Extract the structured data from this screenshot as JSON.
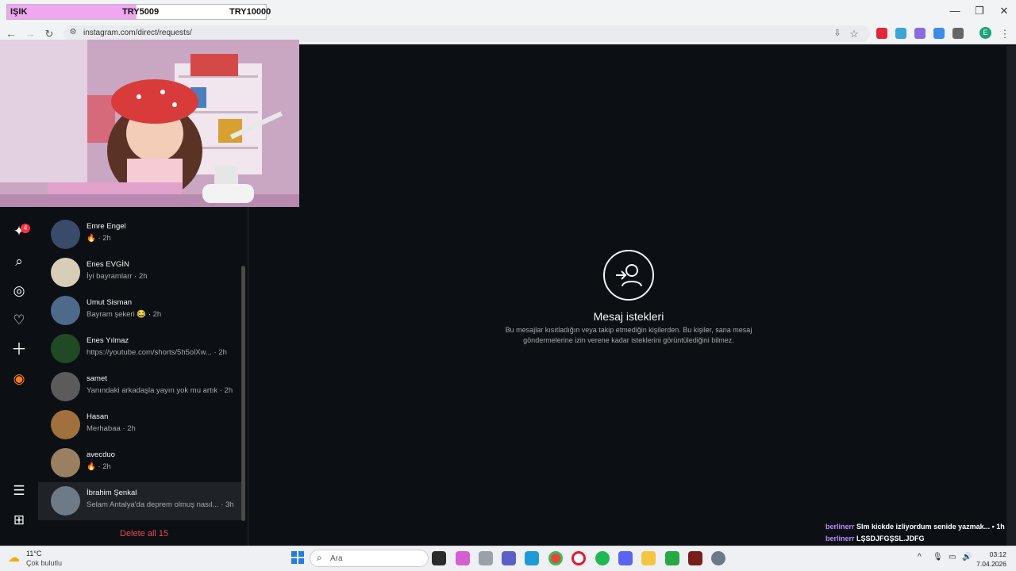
{
  "window": {
    "goal_label_left": "IŞIK",
    "goal_label_mid": "TRY5009",
    "goal_label_right": "TRY10000",
    "goal_progress": 0.5009
  },
  "browser": {
    "url": "instagram.com/direct/requests/",
    "profile_initial": "E"
  },
  "sidebar": {
    "notification_count": "4"
  },
  "requests": [
    {
      "name": "Emre Engel",
      "sub": "🔥 · 2h",
      "avatar_color": "#3a4a6a"
    },
    {
      "name": "Enes EVGİN",
      "sub": "İyi bayramlarr · 2h",
      "avatar_color": "#d8cdb6"
    },
    {
      "name": "Umut Sisman",
      "sub": "Bayram şekeri 😂 · 2h",
      "avatar_color": "#4d6a8a"
    },
    {
      "name": "Enes Yılmaz",
      "sub": "https://youtube.com/shorts/5h5olXw... · 2h",
      "avatar_color": "#1f4a24"
    },
    {
      "name": "samet",
      "sub": "Yanındaki arkadaşla yayın yok mu artık · 2h",
      "avatar_color": "#5b5b5b"
    },
    {
      "name": "Hasan",
      "sub": "Merhabaa · 2h",
      "avatar_color": "#a0713c"
    },
    {
      "name": "avecduo",
      "sub": "🔥 · 2h",
      "avatar_color": "#9a8060"
    },
    {
      "name": "İbrahim Şenkal",
      "sub": "Selam Antalya'da deprem olmuş nasıl... · 3h",
      "avatar_color": "#6e7a86"
    }
  ],
  "delete_all": "Delete all 15",
  "empty": {
    "title": "Mesaj istekleri",
    "description": "Bu mesajlar kısıtladığın veya takip etmediğin kişilerden. Bu kişiler, sana mesaj göndermelerine izin verene kadar isteklerini görüntülediğini bilmez."
  },
  "chat": [
    {
      "user": "berlinerr",
      "msg": "Slm kickde izliyordum senide yazmak... • 1h"
    },
    {
      "user": "berlinerr",
      "msg": "LŞSDJFGŞSL.JDFG"
    }
  ],
  "taskbar": {
    "weather_temp": "11°C",
    "weather_desc": "Çok bulutlu",
    "search_placeholder": "Ara",
    "time": "03:12",
    "date": "7.04.2026"
  },
  "colors": {
    "accent_red": "#ed4956",
    "bg": "#0c1014"
  }
}
